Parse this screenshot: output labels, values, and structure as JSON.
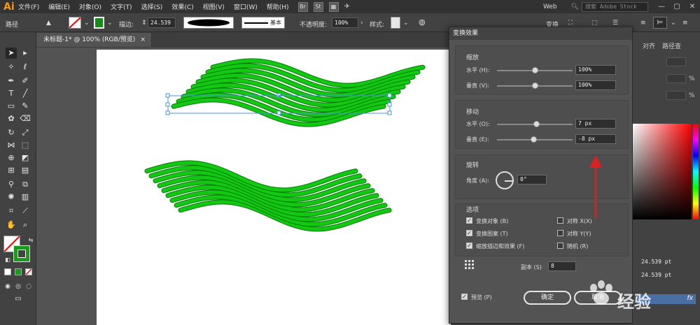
{
  "menubar": {
    "logo": "Ai",
    "items": [
      "文件(F)",
      "编辑(E)",
      "对象(O)",
      "文字(T)",
      "选择(S)",
      "效果(C)",
      "视图(V)",
      "窗口(W)",
      "帮助(H)"
    ],
    "bridge_icon": "Br",
    "stock_icon": "St",
    "workspace": "Web",
    "search_placeholder": "搜索 Adobe Stock"
  },
  "controlbar": {
    "selection_label": "路径",
    "stroke_label": "描边:",
    "stroke_value": "24.539",
    "profile_label": "基本",
    "opacity_label": "不透明度:",
    "opacity_value": "100%",
    "style_label": "样式:",
    "transform_label": "变换"
  },
  "document": {
    "tab_title": "未标题-1* @ 100% (RGB/预览)",
    "tab_close": "×"
  },
  "dialog": {
    "title": "变换效果",
    "scale": {
      "title": "缩放",
      "horizontal_label": "水平 (H):",
      "horizontal_value": "100%",
      "horizontal_slider": 0.5,
      "vertical_label": "垂直 (V):",
      "vertical_value": "100%",
      "vertical_slider": 0.5
    },
    "move": {
      "title": "移动",
      "horizontal_label": "水平 (O):",
      "horizontal_value": "7 px",
      "horizontal_slider": 0.52,
      "vertical_label": "垂直 (E):",
      "vertical_value": "-8 px",
      "vertical_slider": 0.48
    },
    "rotate": {
      "title": "旋转",
      "angle_label": "角度 (A):",
      "angle_value": "0°"
    },
    "options": {
      "title": "选项",
      "transform_objects": "变换对象 (B)",
      "transform_objects_checked": true,
      "transform_patterns": "变换图案 (T)",
      "transform_patterns_checked": true,
      "scale_strokes": "缩放描边和效果 (F)",
      "scale_strokes_checked": true,
      "reflect_x": "对称 X(X)",
      "reflect_x_checked": false,
      "reflect_y": "对称 Y(Y)",
      "reflect_y_checked": false,
      "random": "随机 (R)",
      "random_checked": false
    },
    "copies_label": "副本 (S)",
    "copies_value": "8",
    "preview_label": "预览 (P)",
    "preview_checked": true,
    "ok_label": "确定",
    "cancel_label": "取消"
  },
  "right_panel": {
    "tab_align": "对齐",
    "tab_pathfinder": "路径查",
    "stroke_row1": "24.539 pt",
    "stroke_row2": "24.539 pt",
    "fx_label": "fx",
    "percent": "%"
  },
  "watermark": "经验",
  "colors": {
    "wave_green": "#12c912",
    "wave_dark": "#0a7a0a",
    "arrow_red": "#e02020",
    "selection_blue": "#4a90e2"
  }
}
